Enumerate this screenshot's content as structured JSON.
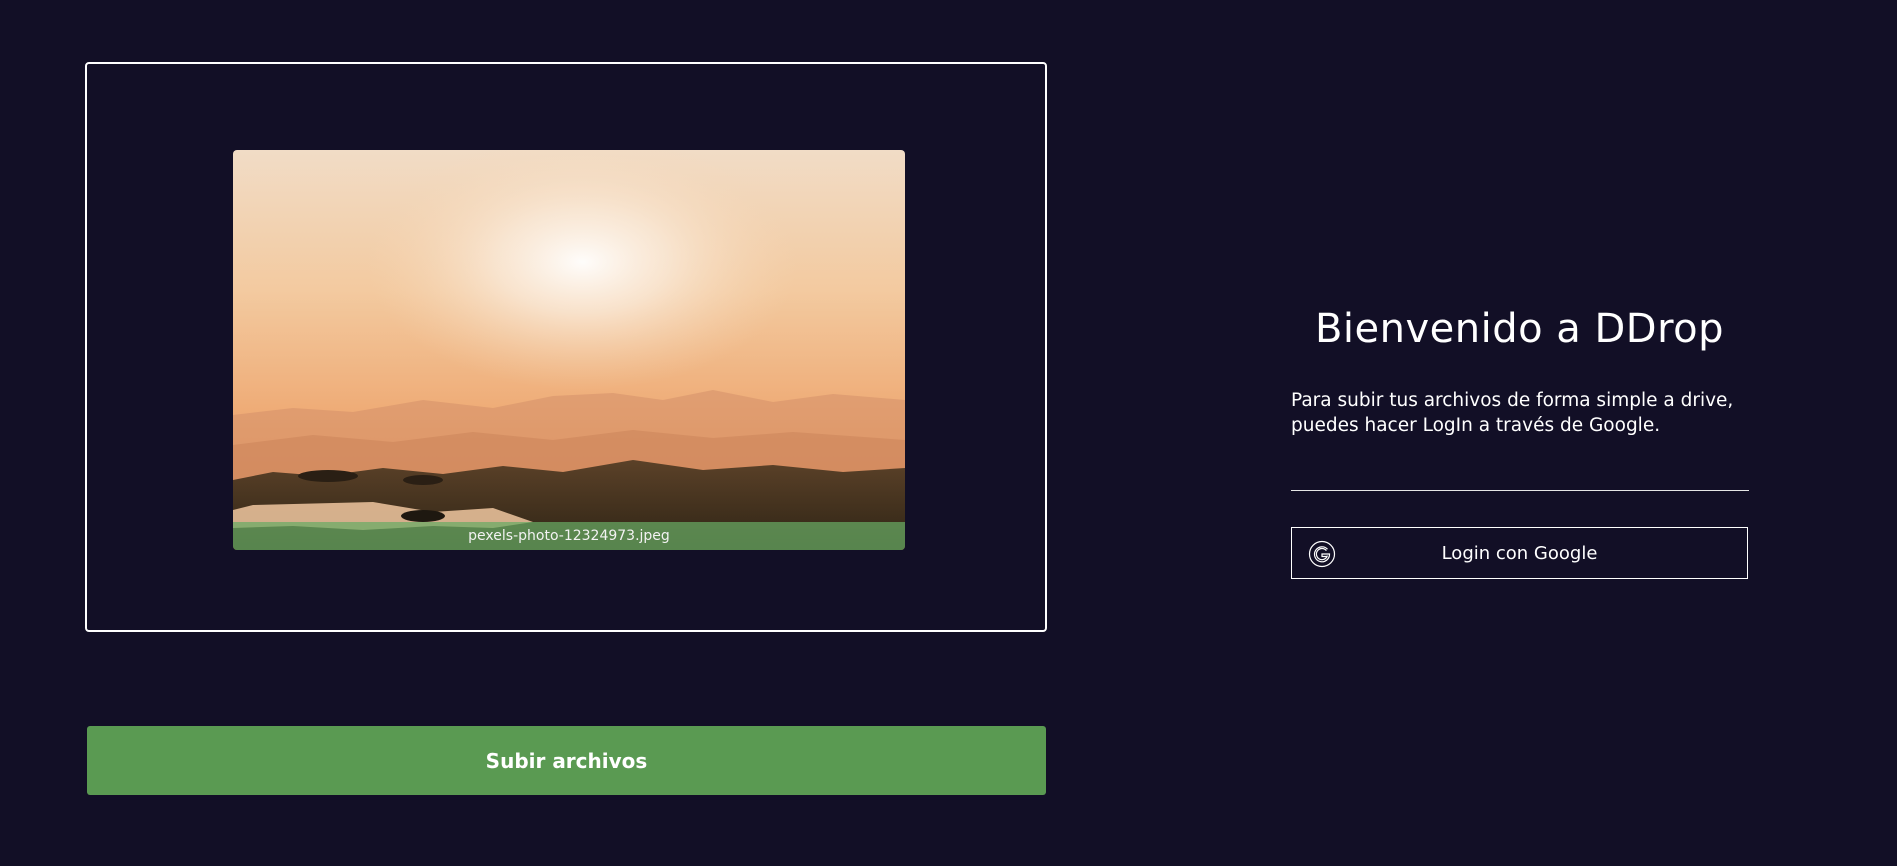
{
  "dropzone": {
    "file_name": "pexels-photo-12324973.jpeg"
  },
  "upload_button": {
    "label": "Subir archivos"
  },
  "welcome": {
    "title": "Bienvenido a DDrop",
    "description_line1": "Para subir tus archivos de forma simple a drive,",
    "description_line2": "puedes hacer LogIn a través de Google."
  },
  "login": {
    "label": "Login con Google",
    "icon": "google-icon"
  },
  "colors": {
    "background": "#120f26",
    "accent_green": "#5a9a52",
    "text": "#ffffff"
  }
}
